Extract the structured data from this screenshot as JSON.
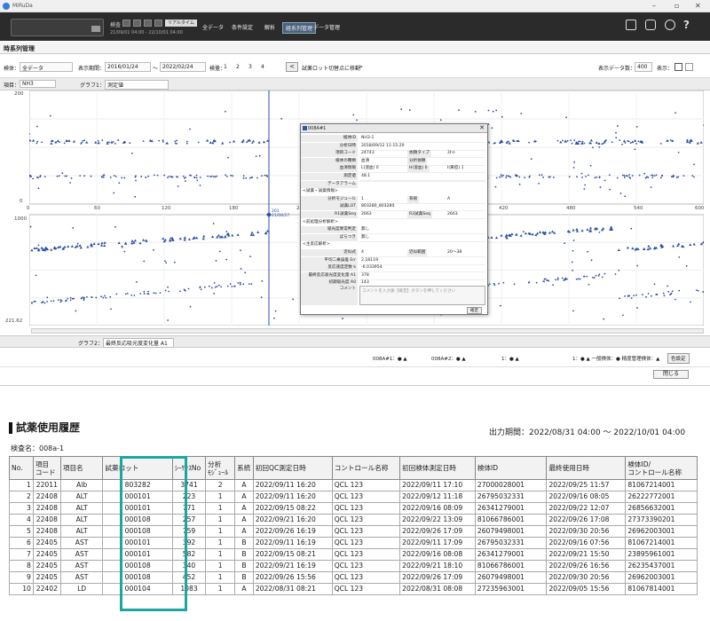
{
  "window": {
    "title": "MiRuDa",
    "controls": [
      "–",
      "▫",
      "✕"
    ]
  },
  "toolbar": {
    "label": "検査",
    "realtime_tag": "リアルタイム",
    "date_range": "21/09/01 04:00 - 22/10/01 04:00",
    "nav": [
      "全データ",
      "条件設定",
      "解析",
      "経系列管理",
      "データ管理"
    ],
    "help": "?"
  },
  "panel": {
    "title": "時系列管理"
  },
  "filters": {
    "specimen_label": "検体：",
    "specimen_value": "全データ",
    "period_label": "表示期間：",
    "date_from": "2016/01/24",
    "tilde": "〜",
    "date_to": "2022/02/24",
    "order_label": "検量：",
    "order_options": [
      "1",
      "2",
      "3",
      "4"
    ],
    "nav_prev": "<",
    "jump_label": "試薬ロット切替点に移動",
    "jump_next": ">",
    "count_label": "表示データ数：",
    "count_value": "400",
    "display_label": "表示："
  },
  "itembar": {
    "item_label": "項目：",
    "item_value": "NH3",
    "graph1_label": "グラフ1：",
    "graph1_value": "測定値"
  },
  "chart_data": {
    "type": "scatter",
    "x_ticks": [
      "0",
      "60",
      "120",
      "180",
      "240",
      "300",
      "360",
      "420",
      "480",
      "540",
      "600"
    ],
    "upper_y_ticks": [
      "200",
      "0"
    ],
    "lower_y_ticks": [
      "1000",
      "221.62"
    ],
    "cursor_label": "201\n21/08/27",
    "series": [
      {
        "name": "008A#1",
        "color": "#2c4fa0"
      },
      {
        "name": "008A#2",
        "color": "#c0392b"
      },
      {
        "name": "1",
        "color": "#1f8a3a"
      }
    ]
  },
  "graph2": {
    "label": "グラフ2：",
    "value": "最終反応吸光度変化量 A1"
  },
  "legend": {
    "items": [
      "008A#1：● ▲",
      "008A#2：● ▲",
      "1：● ▲"
    ],
    "summary": "1：● ▲   一般検体：●   精度管理検体：▲",
    "settings": "色設定"
  },
  "close_label": "閉じる",
  "popup": {
    "title": "008A#1",
    "rows": [
      {
        "label": "検体ID",
        "value": "NH3-1"
      },
      {
        "label": "分析日時",
        "value": "2018/09/12 11:15:20"
      },
      {
        "label": "項目コード",
        "value": "24743",
        "label2": "依頼タイプ",
        "value2": "ｽﾀｯﾄ"
      },
      {
        "label": "検体の種類",
        "value": "血清",
        "label2": "分析依頼",
        "value2": ""
      },
      {
        "label": "血清情報",
        "value": "L(溶血) 0",
        "label2": "H(溶血) 0",
        "value2": "I(黄疸) 1"
      },
      {
        "label": "測定値",
        "value": "48.1"
      },
      {
        "label": "データアラーム",
        "value": ""
      }
    ],
    "section1": "<試薬・試薬情報>",
    "rows2": [
      {
        "label": "分析モジュール",
        "value": "1",
        "label2": "系統",
        "value2": "A"
      },
      {
        "label": "試薬LOT",
        "value": "803280_803280"
      },
      {
        "label": "R1試薬Seq",
        "value": "2663",
        "label2": "R2試薬Seq",
        "value2": "2663"
      }
    ],
    "section2": "<前処理分析解析>",
    "rows3": [
      {
        "label": "吸光度異常判定",
        "value": "無し"
      },
      {
        "label": "ばらつき",
        "value": "無し"
      }
    ],
    "section3": "<主反応解析>",
    "rows4": [
      {
        "label": "近似式",
        "value": "4",
        "label2": "近似範囲",
        "value2": "20〜38"
      },
      {
        "label": "平均二乗誤差 Err",
        "value": "2.18119"
      },
      {
        "label": "反応速度定数 k",
        "value": "-6.033954"
      },
      {
        "label": "最終反応吸光度変化量 A1",
        "value": "378"
      },
      {
        "label": "初期吸光度 A0",
        "value": "143"
      }
    ],
    "comment_label": "コメント",
    "comment_placeholder": "コメントを入力後【確定】ボタンを押してください",
    "confirm": "確定"
  },
  "history": {
    "title": "試薬使用履歴",
    "period": "出力期間：2022/08/31 04:00 〜 2022/10/01 04:00",
    "spec_line": "検査名：008a-1",
    "headers": [
      "No.",
      "項目\nコード",
      "項目名",
      "試薬ロット",
      "ｼｰｹﾝｽNo",
      "分析\nﾓｼﾞｭｰﾙ",
      "系統",
      "初回QC測定日時",
      "コントロール名称",
      "初回検体測定日時",
      "検体ID",
      "最終使用日時",
      "検体ID/\nコントロール名称"
    ],
    "rows": [
      [
        "1",
        "22011",
        "Alb",
        "803282",
        "3741",
        "2",
        "A",
        "2022/09/11 16:20",
        "QCL 123",
        "2022/09/11 17:10",
        "27000028001",
        "2022/09/25 11:57",
        "81067214001"
      ],
      [
        "2",
        "22408",
        "ALT",
        "000101",
        "223",
        "1",
        "A",
        "2022/09/11 16:20",
        "QCL 123",
        "2022/09/12 11:18",
        "26795032331",
        "2022/09/16 08:05",
        "26222772001"
      ],
      [
        "3",
        "22408",
        "ALT",
        "000101",
        "771",
        "1",
        "A",
        "2022/09/15 08:22",
        "QCL 123",
        "2022/09/16 08:09",
        "26341279001",
        "2022/09/22 12:07",
        "26856632001"
      ],
      [
        "4",
        "22408",
        "ALT",
        "000108",
        "257",
        "1",
        "A",
        "2022/09/21 16:20",
        "QCL 123",
        "2022/09/22 13:09",
        "81066786001",
        "2022/09/26 17:08",
        "27373390201"
      ],
      [
        "5",
        "22408",
        "ALT",
        "000108",
        "759",
        "1",
        "A",
        "2022/09/26 16:19",
        "QCL 123",
        "2022/09/26 17:09",
        "26079498001",
        "2022/09/30 20:56",
        "26962003001"
      ],
      [
        "6",
        "22405",
        "AST",
        "000101",
        "392",
        "1",
        "B",
        "2022/09/11 16:19",
        "QCL 123",
        "2022/09/11 17:09",
        "26795032331",
        "2022/09/16 07:56",
        "81067214001"
      ],
      [
        "7",
        "22405",
        "AST",
        "000101",
        "582",
        "1",
        "B",
        "2022/09/15 08:21",
        "QCL 123",
        "2022/09/16 08:08",
        "26341279001",
        "2022/09/21 15:50",
        "23895961001"
      ],
      [
        "8",
        "22405",
        "AST",
        "000108",
        "340",
        "1",
        "B",
        "2022/09/21 16:19",
        "QCL 123",
        "2022/09/21 18:10",
        "81066786001",
        "2022/09/26 16:56",
        "26235437001"
      ],
      [
        "9",
        "22405",
        "AST",
        "000108",
        "452",
        "1",
        "B",
        "2022/09/26 15:56",
        "QCL 123",
        "2022/09/26 17:09",
        "26079498001",
        "2022/09/30 20:56",
        "26962003001"
      ],
      [
        "10",
        "22402",
        "LD",
        "000104",
        "1083",
        "1",
        "A",
        "2022/08/31 08:21",
        "QCL 123",
        "2022/08/31 08:08",
        "27235963001",
        "2022/09/05 15:56",
        "81067814001"
      ]
    ]
  },
  "colors": {
    "toolbar": "#2b2b2b",
    "highlight": "#1ba7a0",
    "series_blue": "#2c4fa0",
    "cursor": "#2c4fa0"
  }
}
